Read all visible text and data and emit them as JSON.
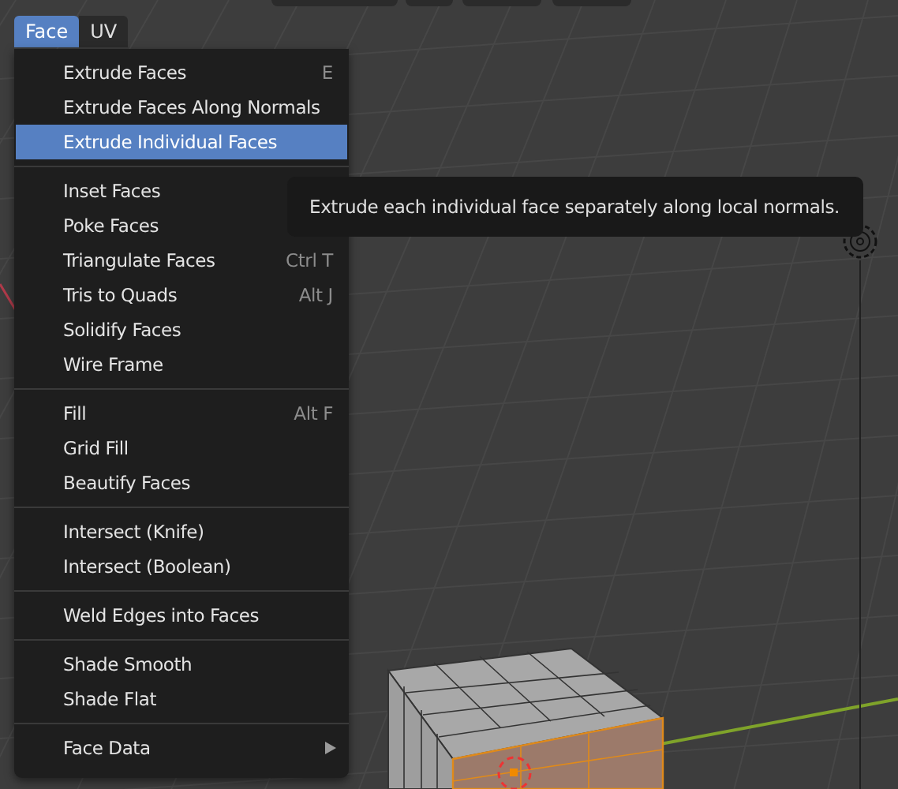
{
  "menu_bar": [
    {
      "label": "Face",
      "selected": true
    },
    {
      "label": "UV",
      "selected": false
    }
  ],
  "menu": {
    "groups": [
      {
        "items": [
          {
            "label": "Extrude Faces",
            "shortcut": "E",
            "selected": false
          },
          {
            "label": "Extrude Faces Along Normals",
            "selected": false
          },
          {
            "label": "Extrude Individual Faces",
            "selected": true
          }
        ]
      },
      {
        "items": [
          {
            "label": "Inset Faces",
            "selected": false
          },
          {
            "label": "Poke Faces",
            "selected": false
          },
          {
            "label": "Triangulate Faces",
            "shortcut": "Ctrl T",
            "selected": false
          },
          {
            "label": "Tris to Quads",
            "shortcut": "Alt J",
            "selected": false
          },
          {
            "label": "Solidify Faces",
            "selected": false
          },
          {
            "label": "Wire Frame",
            "selected": false
          }
        ]
      },
      {
        "items": [
          {
            "label": "Fill",
            "shortcut": "Alt F",
            "selected": false
          },
          {
            "label": "Grid Fill",
            "selected": false
          },
          {
            "label": "Beautify Faces",
            "selected": false
          }
        ]
      },
      {
        "items": [
          {
            "label": "Intersect (Knife)",
            "selected": false
          },
          {
            "label": "Intersect (Boolean)",
            "selected": false
          }
        ]
      },
      {
        "items": [
          {
            "label": "Weld Edges into Faces",
            "selected": false
          }
        ]
      },
      {
        "items": [
          {
            "label": "Shade Smooth",
            "selected": false
          },
          {
            "label": "Shade Flat",
            "selected": false
          }
        ]
      },
      {
        "items": [
          {
            "label": "Face Data",
            "selected": false,
            "submenu": true
          }
        ]
      }
    ]
  },
  "tooltip": "Extrude each individual face separately along local normals."
}
